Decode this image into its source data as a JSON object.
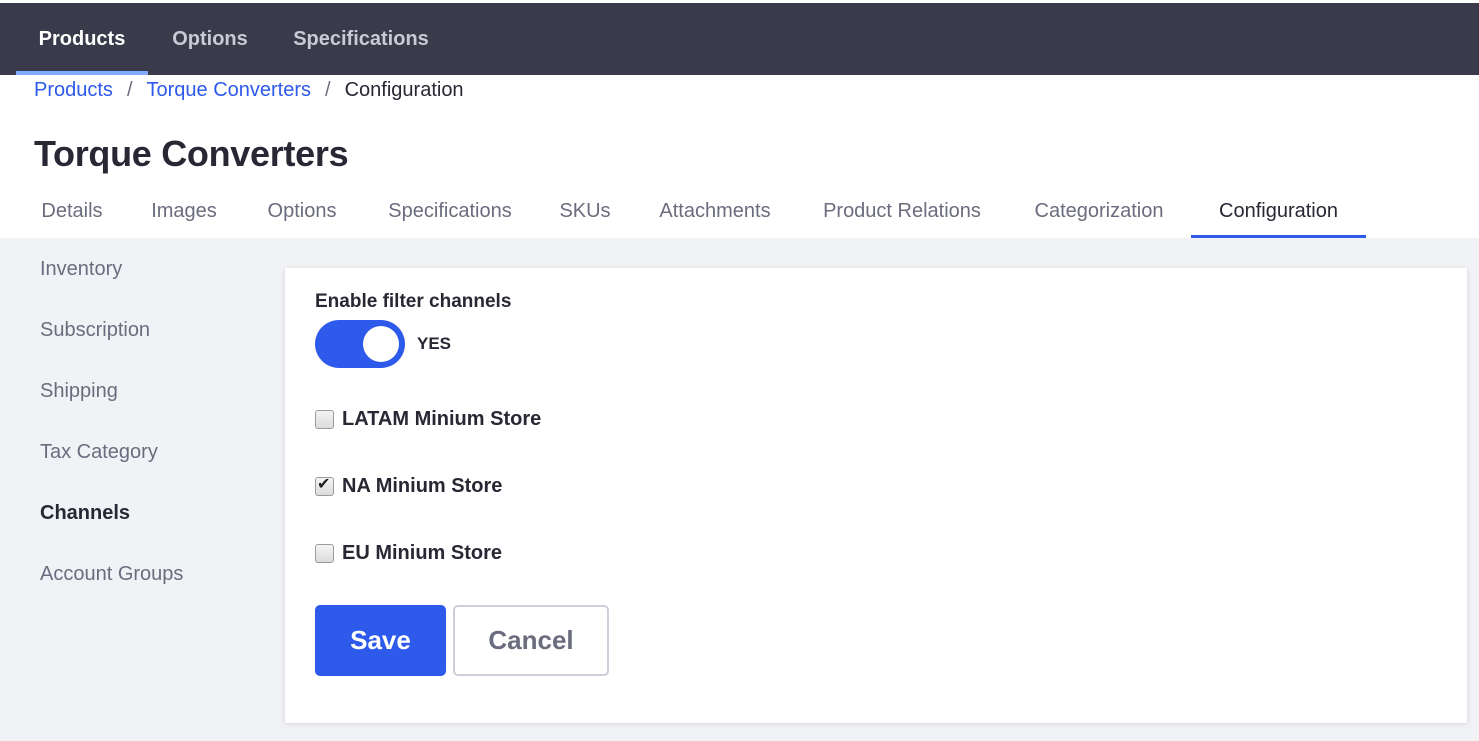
{
  "navbar": {
    "items": [
      {
        "label": "Products",
        "active": true
      },
      {
        "label": "Options",
        "active": false
      },
      {
        "label": "Specifications",
        "active": false
      }
    ]
  },
  "breadcrumb": {
    "items": [
      {
        "label": "Products",
        "link": true
      },
      {
        "label": "Torque Converters",
        "link": true
      },
      {
        "label": "Configuration",
        "link": false
      }
    ],
    "separator": "/"
  },
  "page_title": "Torque Converters",
  "tabs": [
    {
      "label": "Details",
      "active": false
    },
    {
      "label": "Images",
      "active": false
    },
    {
      "label": "Options",
      "active": false
    },
    {
      "label": "Specifications",
      "active": false
    },
    {
      "label": "SKUs",
      "active": false
    },
    {
      "label": "Attachments",
      "active": false
    },
    {
      "label": "Product Relations",
      "active": false
    },
    {
      "label": "Categorization",
      "active": false
    },
    {
      "label": "Configuration",
      "active": true
    }
  ],
  "sidebar": {
    "items": [
      {
        "label": "Inventory",
        "active": false
      },
      {
        "label": "Subscription",
        "active": false
      },
      {
        "label": "Shipping",
        "active": false
      },
      {
        "label": "Tax Category",
        "active": false
      },
      {
        "label": "Channels",
        "active": true
      },
      {
        "label": "Account Groups",
        "active": false
      }
    ]
  },
  "channels_form": {
    "enable_label": "Enable filter channels",
    "toggle_on": true,
    "toggle_text": "YES",
    "channels": [
      {
        "label": "LATAM Minium Store",
        "checked": false
      },
      {
        "label": "NA Minium Store",
        "checked": true
      },
      {
        "label": "EU Minium Store",
        "checked": false
      }
    ],
    "save_label": "Save",
    "cancel_label": "Cancel"
  },
  "colors": {
    "navbar_bg": "#393a4a",
    "primary": "#2e5aeb",
    "nav_active_indicator": "#80acff",
    "page_bg": "#f1f2f5"
  }
}
